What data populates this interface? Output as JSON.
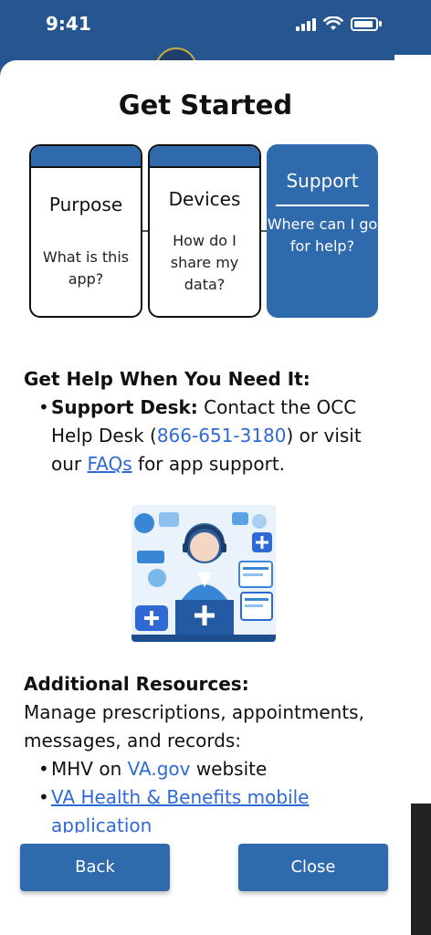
{
  "status_bar": {
    "time": "9:41"
  },
  "sheet": {
    "title": "Get Started"
  },
  "steps": [
    {
      "title": "Purpose",
      "question": "What is this app?"
    },
    {
      "title": "Devices",
      "question": "How do I share my data?"
    },
    {
      "title": "Support",
      "question": "Where can I go for help?"
    }
  ],
  "help": {
    "heading": "Get Help When You Need It:",
    "desk_label": "Support Desk:",
    "desk_text_1": " Contact the OCC Help Desk (",
    "phone": "866-651-3180",
    "desk_text_2": ") or visit our ",
    "faq_link": "FAQs",
    "desk_text_3": " for app support."
  },
  "resources": {
    "heading": "Additional Resources:",
    "intro": "Manage prescriptions, appointments, messages, and records:",
    "mhv_prefix": "MHV on ",
    "mhv_link": "VA.gov",
    "mhv_suffix": " website",
    "mobile_link": "VA Health & Benefits mobile application"
  },
  "buttons": {
    "back": "Back",
    "close": "Close"
  },
  "colors": {
    "primary": "#2f6aad",
    "link": "#2f6ad4",
    "background_app": "#25568f"
  },
  "icons": [
    "signal-icon",
    "wifi-icon",
    "battery-icon",
    "support-agent-illustration"
  ]
}
